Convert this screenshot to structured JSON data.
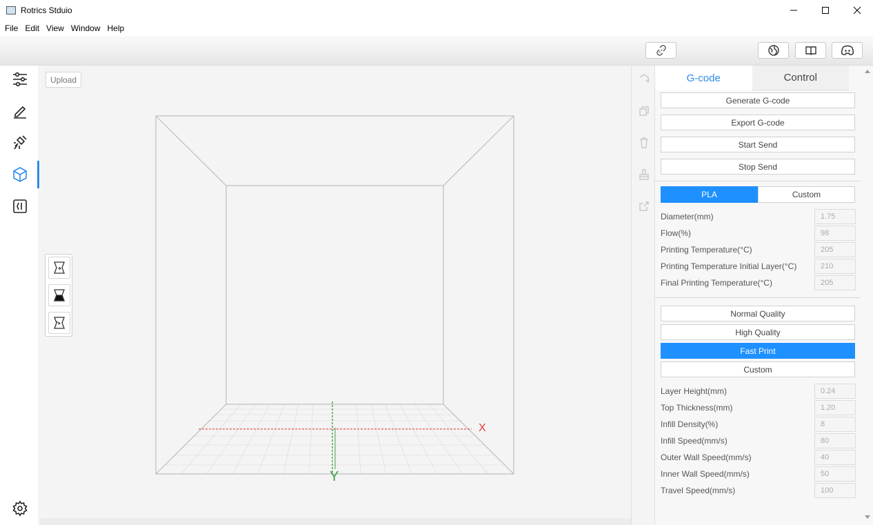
{
  "window": {
    "title": "Rotrics Stduio"
  },
  "menu": [
    "File",
    "Edit",
    "View",
    "Window",
    "Help"
  ],
  "toolbar": {
    "icons": [
      "disconnect-icon",
      "globe-icon",
      "book-icon",
      "discord-icon"
    ]
  },
  "sidebar": {
    "items": [
      {
        "name": "settings-sliders-icon"
      },
      {
        "name": "pen-icon"
      },
      {
        "name": "laser-icon"
      },
      {
        "name": "cube-icon",
        "active": true
      },
      {
        "name": "code-icon"
      }
    ],
    "bottom": "gear-icon"
  },
  "viewport": {
    "upload_label": "Upload",
    "axis_x_label": "X",
    "axis_y_label": "Y"
  },
  "panel": {
    "tabs": {
      "gcode": "G-code",
      "control": "Control"
    },
    "actions": {
      "generate": "Generate G-code",
      "export": "Export G-code",
      "start": "Start Send",
      "stop": "Stop Send"
    },
    "material": {
      "pla": "PLA",
      "custom": "Custom"
    },
    "material_params": [
      {
        "label": "Diameter(mm)",
        "value": "1.75"
      },
      {
        "label": "Flow(%)",
        "value": "98"
      },
      {
        "label": "Printing Temperature(°C)",
        "value": "205"
      },
      {
        "label": "Printing Temperature Initial Layer(°C)",
        "value": "210"
      },
      {
        "label": "Final Printing Temperature(°C)",
        "value": "205"
      }
    ],
    "quality": {
      "normal": "Normal Quality",
      "high": "High Quality",
      "fast": "Fast Print",
      "custom": "Custom",
      "selected": "fast"
    },
    "quality_params": [
      {
        "label": "Layer Height(mm)",
        "value": "0.24"
      },
      {
        "label": "Top Thickness(mm)",
        "value": "1.20"
      },
      {
        "label": "Infill Density(%)",
        "value": "8"
      },
      {
        "label": "Infill Speed(mm/s)",
        "value": "80"
      },
      {
        "label": "Outer Wall Speed(mm/s)",
        "value": "40"
      },
      {
        "label": "Inner Wall Speed(mm/s)",
        "value": "50"
      },
      {
        "label": "Travel Speed(mm/s)",
        "value": "100"
      }
    ]
  },
  "colors": {
    "accent": "#1e90ff",
    "x_axis": "#e53935",
    "y_axis": "#43a047"
  }
}
